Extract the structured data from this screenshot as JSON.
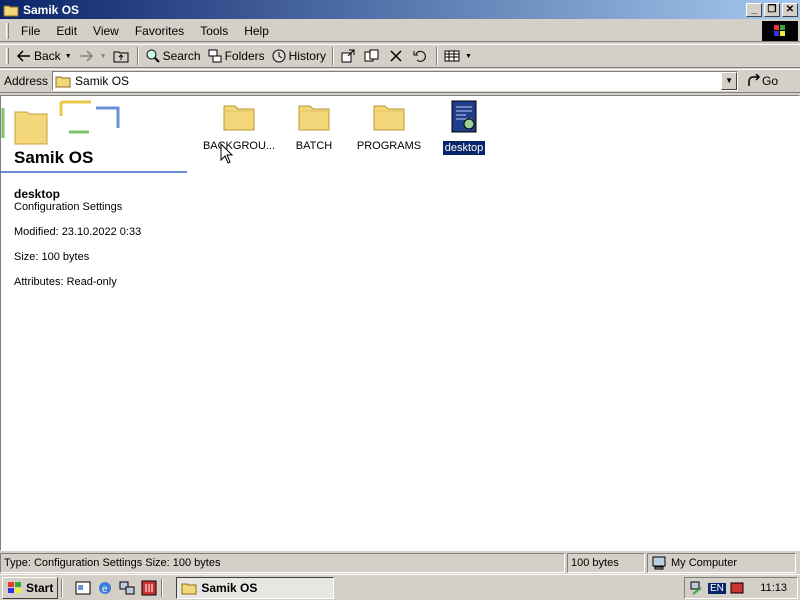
{
  "window": {
    "title": "Samik OS"
  },
  "menu": [
    "File",
    "Edit",
    "View",
    "Favorites",
    "Tools",
    "Help"
  ],
  "toolbar": {
    "back": "Back",
    "search": "Search",
    "folders": "Folders",
    "history": "History"
  },
  "address": {
    "label": "Address",
    "value": "Samik OS",
    "go": "Go"
  },
  "webview": {
    "title": "Samik OS",
    "selected_name": "desktop",
    "selected_type": "Configuration Settings",
    "modified": "Modified: 23.10.2022 0:33",
    "size": "Size: 100 bytes",
    "attributes": "Attributes: Read-only"
  },
  "items": [
    {
      "label": "BACKGROU...",
      "kind": "folder"
    },
    {
      "label": "BATCH",
      "kind": "folder"
    },
    {
      "label": "PROGRAMS",
      "kind": "folder"
    },
    {
      "label": "desktop",
      "kind": "config-file",
      "selected": true
    }
  ],
  "statusbar": {
    "info": "Type: Configuration Settings Size: 100 bytes",
    "size": "100 bytes",
    "zone": "My Computer"
  },
  "taskbar": {
    "start": "Start",
    "task": "Samik OS",
    "lang": "EN",
    "clock": "11:13"
  },
  "colors": {
    "title_start": "#0a246a",
    "title_end": "#a6caf0",
    "selection": "#0a246a",
    "folder": "#f4d77a"
  }
}
